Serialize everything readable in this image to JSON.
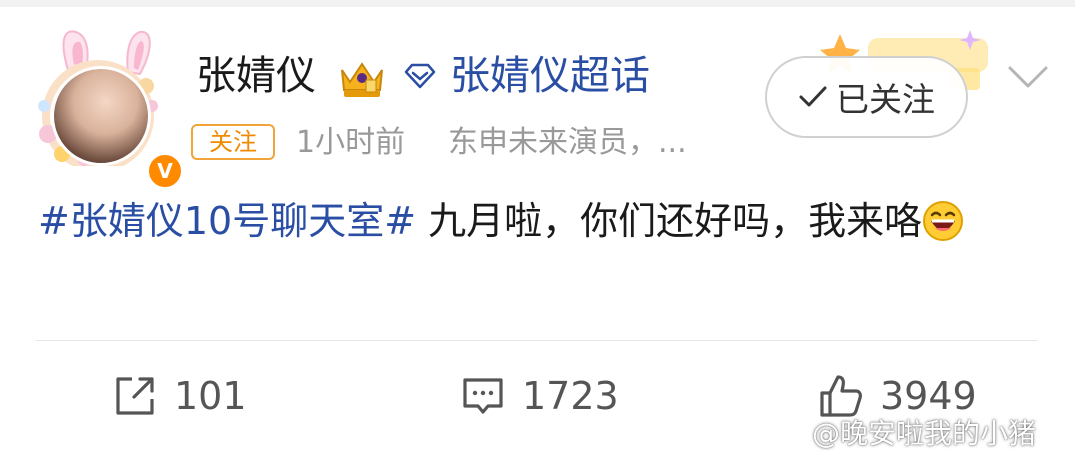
{
  "post": {
    "author": {
      "name": "张婧仪",
      "supertopic": "张婧仪超话",
      "follow_tag": "关注",
      "time": "1小时前",
      "source": "东申未来演员，..."
    },
    "follow_button": {
      "label": "已关注"
    },
    "content": {
      "hashtag": "#张婧仪10号聊天室#",
      "text": " 九月啦，你们还好吗，我来咯"
    },
    "actions": {
      "repost_count": "101",
      "comment_count": "1723",
      "like_count": "3949"
    },
    "watermark": "@晚安啦我的小猪"
  },
  "colors": {
    "link_blue": "#2a4ea4",
    "follow_orange": "#f08a00",
    "meta_gray": "#999999",
    "vip_orange": "#ff8a00"
  },
  "icons": [
    "crown-badge-icon",
    "supertopic-diamond-icon",
    "check-icon",
    "chevron-down-icon",
    "repost-icon",
    "comment-icon",
    "like-icon",
    "laugh-emoji-icon",
    "vip-v-icon"
  ]
}
